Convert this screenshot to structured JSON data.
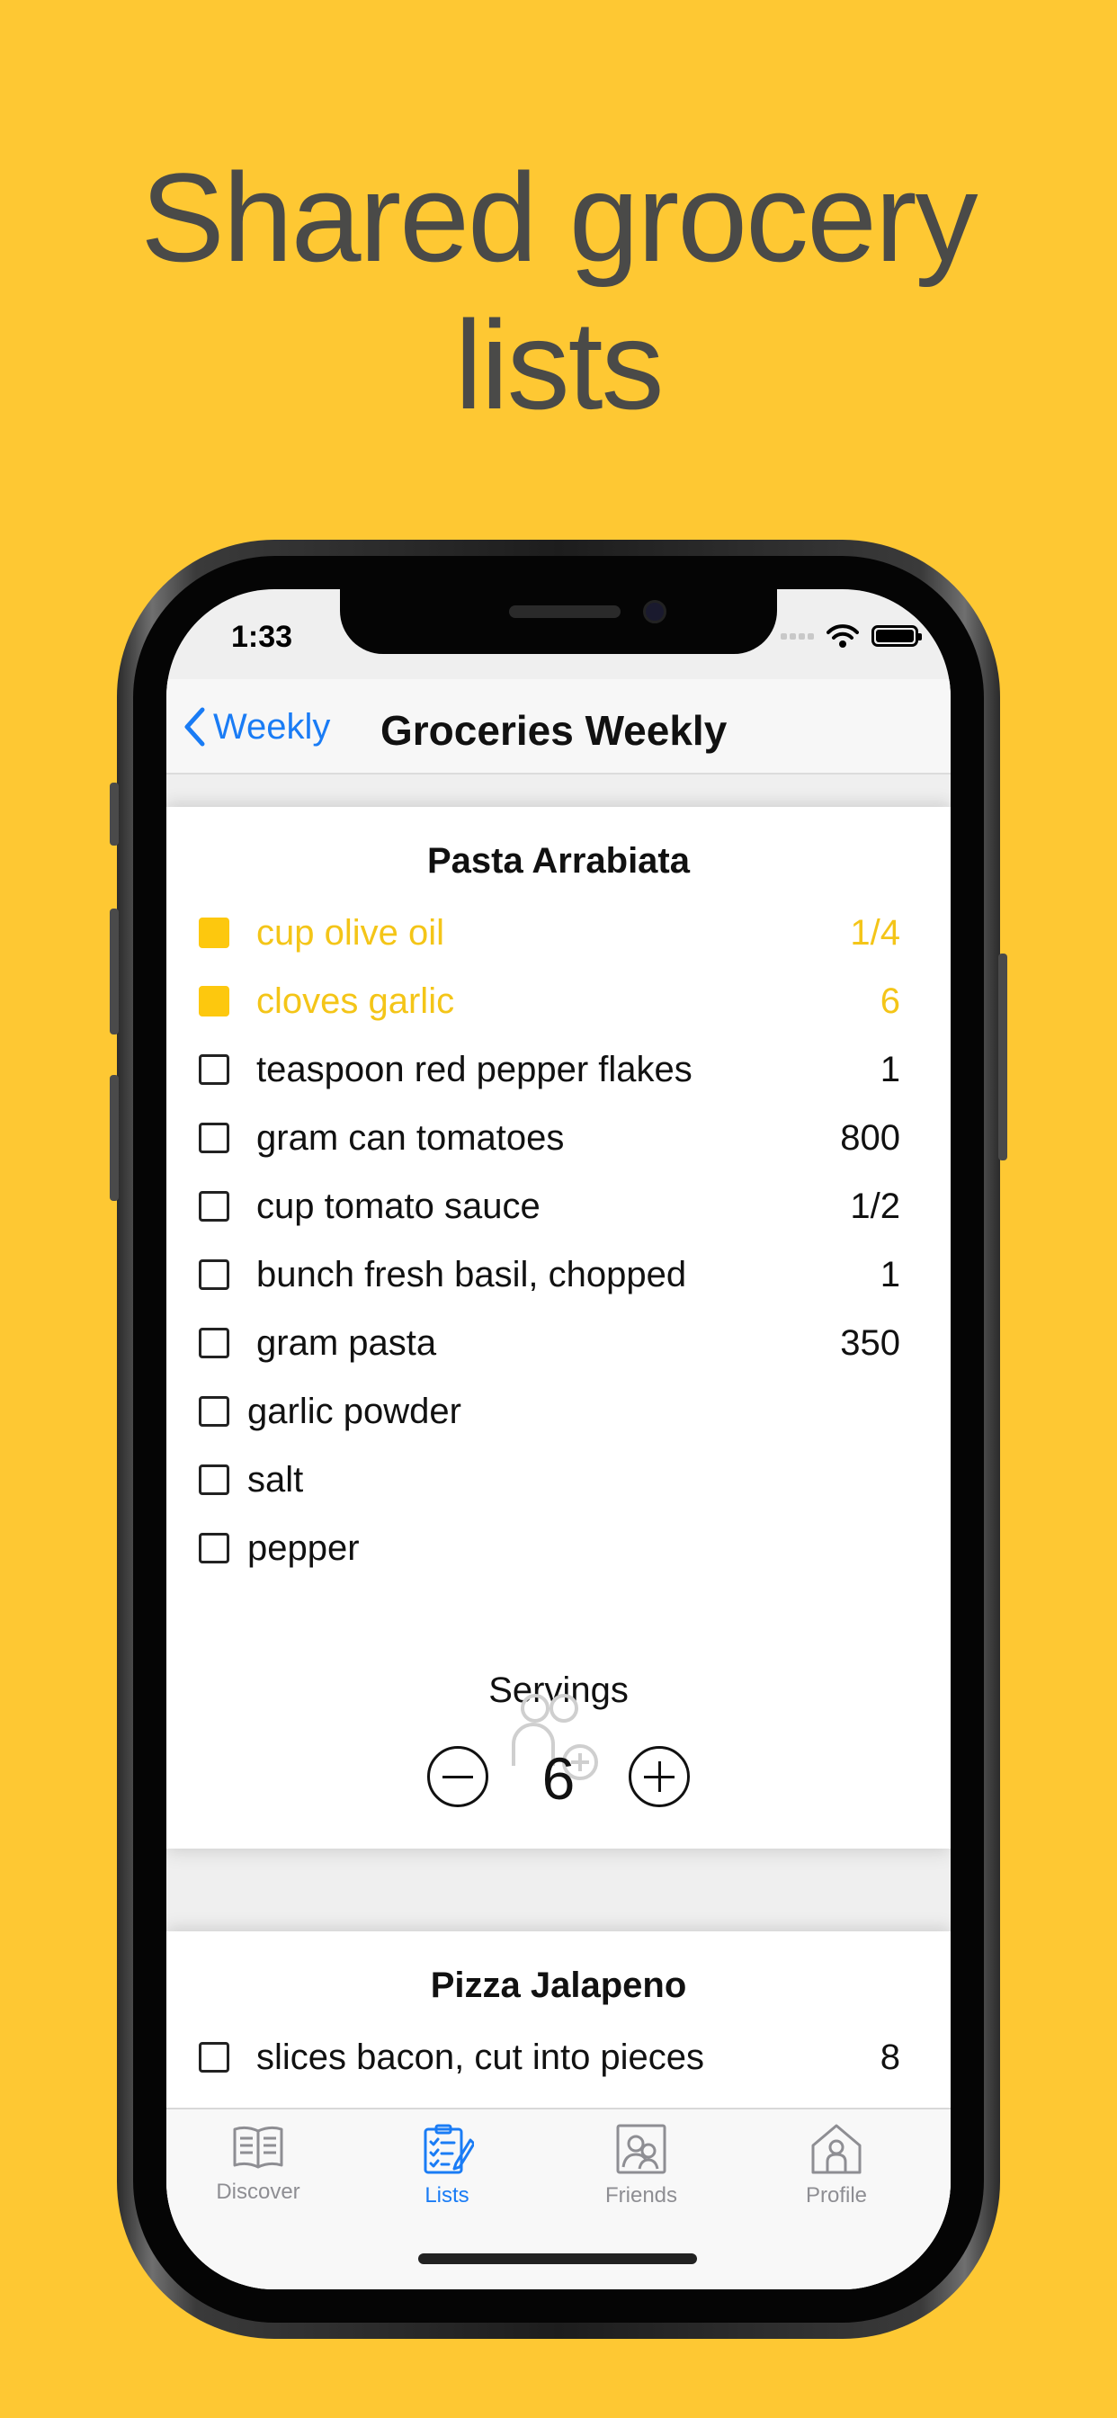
{
  "headline": {
    "line1": "Shared grocery",
    "line2": "lists"
  },
  "status": {
    "time": "1:33"
  },
  "nav": {
    "back_label": "Weekly",
    "title": "Groceries Weekly"
  },
  "recipes": [
    {
      "title": "Pasta Arrabiata",
      "items": [
        {
          "name": "cup olive oil",
          "qty": "1/4",
          "checked": true
        },
        {
          "name": "cloves garlic",
          "qty": "6",
          "checked": true
        },
        {
          "name": "teaspoon red pepper flakes",
          "qty": "1",
          "checked": false
        },
        {
          "name": "gram can tomatoes",
          "qty": "800",
          "checked": false
        },
        {
          "name": "cup tomato sauce",
          "qty": "1/2",
          "checked": false
        },
        {
          "name": "bunch fresh basil, chopped",
          "qty": "1",
          "checked": false
        },
        {
          "name": "gram pasta",
          "qty": "350",
          "checked": false
        },
        {
          "name": "garlic powder",
          "qty": "",
          "checked": false
        },
        {
          "name": "salt",
          "qty": "",
          "checked": false
        },
        {
          "name": "pepper",
          "qty": "",
          "checked": false
        }
      ],
      "servings_label": "Servings",
      "servings": "6"
    },
    {
      "title": "Pizza Jalapeno",
      "items": [
        {
          "name": "slices bacon, cut into pieces",
          "qty": "8",
          "checked": false
        }
      ]
    }
  ],
  "tabs": [
    {
      "label": "Discover",
      "icon": "book-icon"
    },
    {
      "label": "Lists",
      "icon": "checklist-icon",
      "active": true
    },
    {
      "label": "Friends",
      "icon": "friends-icon"
    },
    {
      "label": "Profile",
      "icon": "profile-icon"
    }
  ],
  "colors": {
    "background": "#FEC833",
    "accent": "#1a7cf5",
    "checked": "#FDC80E"
  }
}
